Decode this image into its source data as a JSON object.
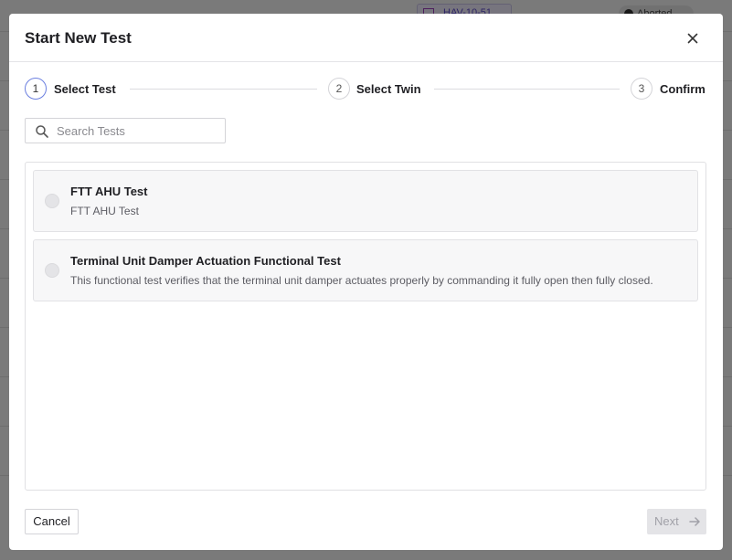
{
  "background": {
    "chip_text": "HAV-10-51",
    "status_text": "Aborted"
  },
  "modal": {
    "title": "Start New Test",
    "close_icon": "close-icon"
  },
  "stepper": {
    "steps": [
      {
        "number": "1",
        "label": "Select Test",
        "active": true
      },
      {
        "number": "2",
        "label": "Select Twin",
        "active": false
      },
      {
        "number": "3",
        "label": "Confirm",
        "active": false
      }
    ]
  },
  "search": {
    "placeholder": "Search Tests",
    "value": "",
    "icon": "search-icon"
  },
  "tests": [
    {
      "title": "FTT AHU Test",
      "description": "FTT AHU Test",
      "selected": false
    },
    {
      "title": "Terminal Unit Damper Actuation Functional Test",
      "description": "This functional test verifies that the terminal unit damper actuates properly by commanding it fully open then fully closed.",
      "selected": false
    }
  ],
  "footer": {
    "cancel_label": "Cancel",
    "next_label": "Next",
    "next_icon": "arrow-right-icon",
    "next_disabled": true
  },
  "colors": {
    "accent": "#6b7fe0",
    "overlay": "rgba(0,0,0,0.5)",
    "disabled_button": "#e4e4e7"
  }
}
